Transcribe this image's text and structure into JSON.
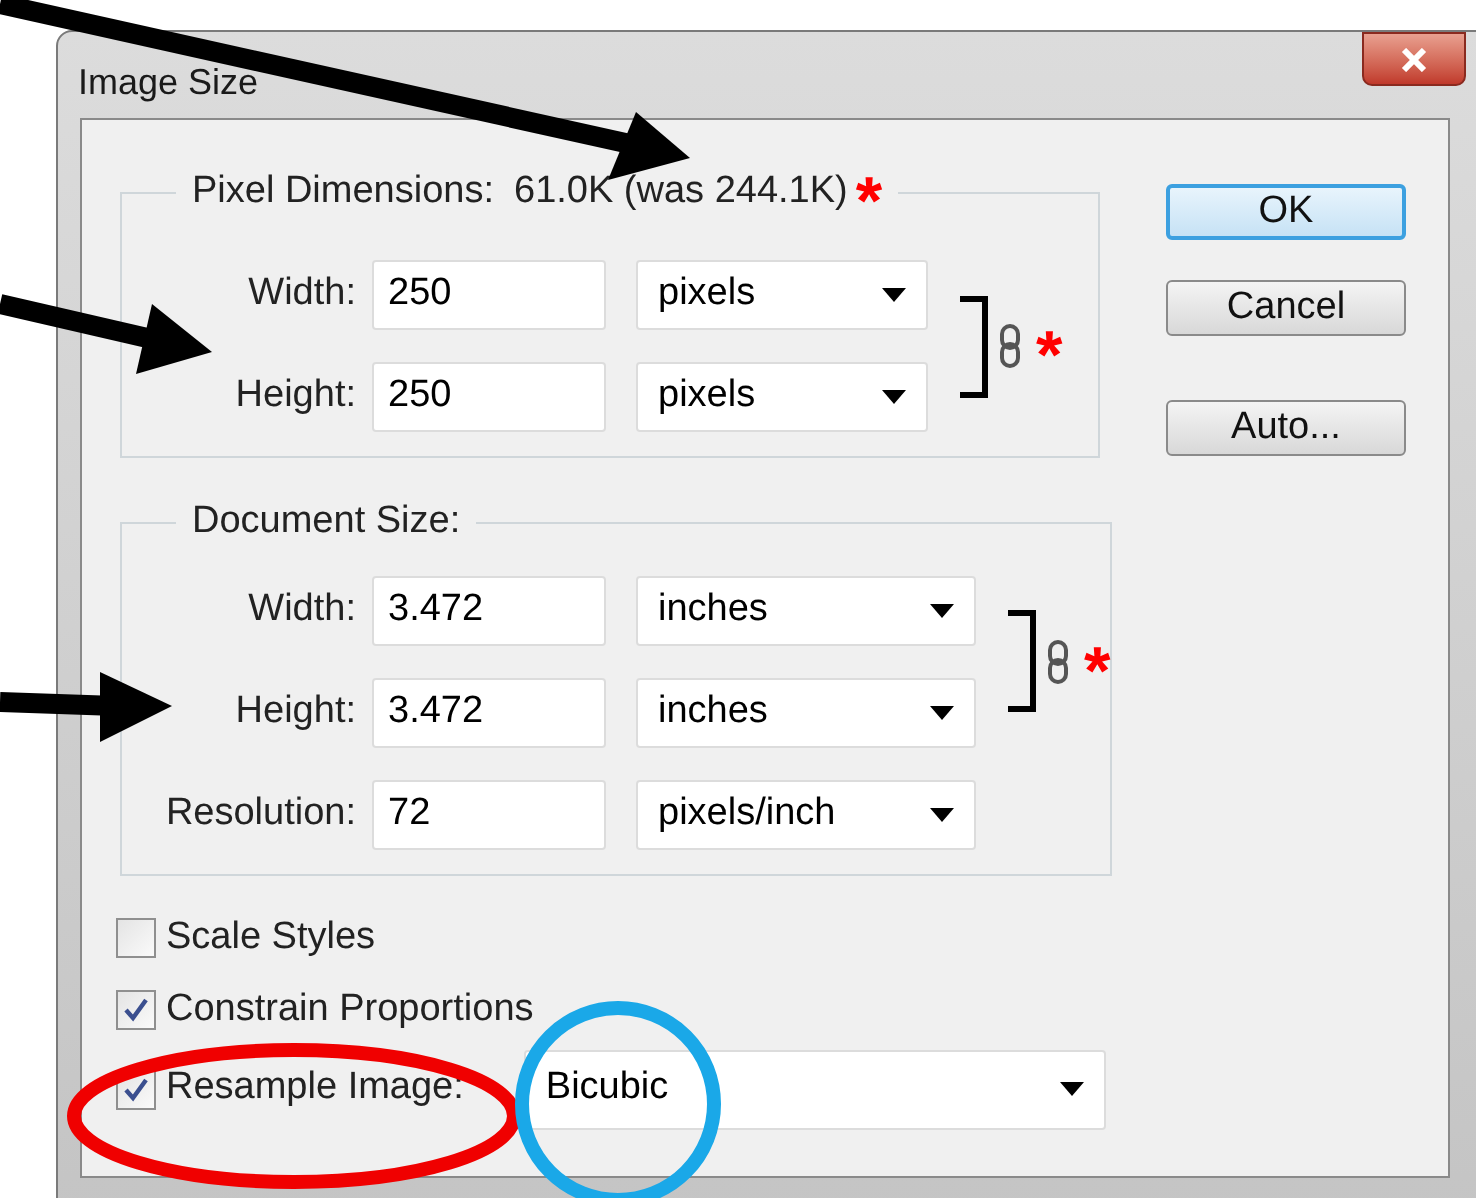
{
  "window": {
    "title": "Image Size"
  },
  "pixel_dimensions": {
    "label": "Pixel Dimensions:",
    "value": "61.0K (was 244.1K)",
    "annotation": "*",
    "link_annotation": "*",
    "fields": [
      {
        "label": "Width:",
        "value": "250",
        "unit": "pixels",
        "linked": true
      },
      {
        "label": "Height:",
        "value": "250",
        "unit": "pixels",
        "linked": true
      }
    ]
  },
  "document_size": {
    "label": "Document Size:",
    "link_annotation": "*",
    "fields": [
      {
        "label": "Width:",
        "value": "3.472",
        "unit": "inches",
        "linked": true
      },
      {
        "label": "Height:",
        "value": "3.472",
        "unit": "inches",
        "linked": true
      },
      {
        "label": "Resolution:",
        "value": "72",
        "unit": "pixels/inch",
        "linked": false
      }
    ]
  },
  "options": [
    {
      "kind": "checkbox",
      "label": "Scale Styles",
      "checked": false
    },
    {
      "kind": "checkbox",
      "label": "Constrain Proportions",
      "checked": true
    },
    {
      "kind": "checkbox-select",
      "label": "Resample Image:",
      "checked": true,
      "value": "Bicubic"
    }
  ],
  "buttons": [
    {
      "label": "OK",
      "default": true
    },
    {
      "label": "Cancel",
      "default": false
    },
    {
      "label": "Auto...",
      "default": false
    }
  ]
}
